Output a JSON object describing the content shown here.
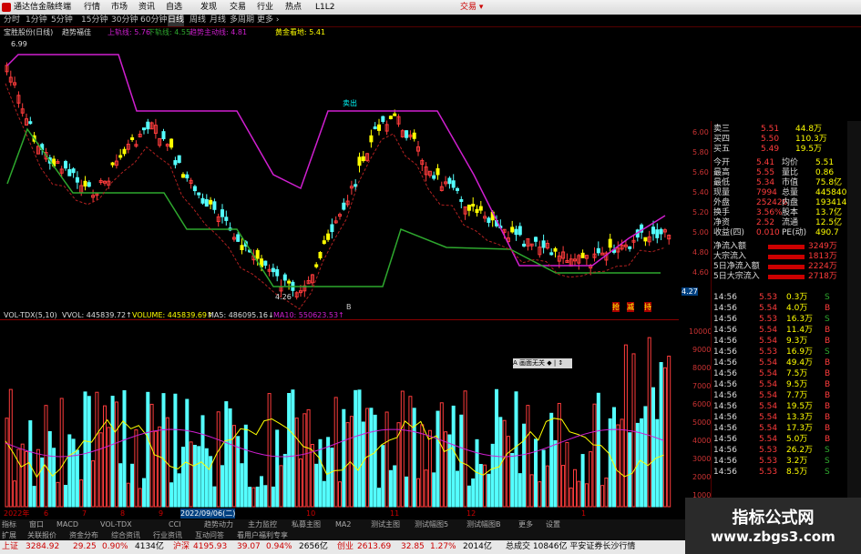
{
  "window": {
    "title": "通达信金融终端",
    "menu": [
      "行情",
      "市场",
      "资讯",
      "自选",
      "发现",
      "交易",
      "行业",
      "热点",
      "L1L2"
    ],
    "right_label": "交易 ▾"
  },
  "periods": [
    "分时",
    "1分钟",
    "5分钟",
    "15分钟",
    "30分钟",
    "60分钟",
    "日线",
    "周线",
    "月线",
    "多周期",
    "更多 ›"
  ],
  "active_period": "日线",
  "info": {
    "stock": "宝胜股份(日线)",
    "indicator": "趋势福佳",
    "upper": "上轨线: 5.76",
    "lower": "下轨线: 4.55",
    "main": "趋势主动线: 4.81",
    "gold": "黄金看地: 5.41"
  },
  "chart_labels": {
    "high": "6.99",
    "low": "4.26",
    "sell": "卖出",
    "buy_markers": [
      "抢",
      "减",
      "持"
    ],
    "b_marker": "B",
    "right_price": "4.27"
  },
  "price_axis": [
    "6.00",
    "5.80",
    "5.60",
    "5.40",
    "5.20",
    "5.00",
    "4.80",
    "4.60"
  ],
  "vol_info": {
    "name": "VOL-TDX(5,10)",
    "vvol": "VVOL: 445839.72↑",
    "volume": "VOLUME: 445839.69↑",
    "ma5": "MA5: 486095.16↓",
    "ma10": "MA10: 550623.53↑"
  },
  "vol_axis": [
    "10000",
    "9000",
    "8000",
    "7000",
    "6000",
    "5000",
    "4000",
    "3000",
    "2000",
    "1000"
  ],
  "popup": "A 画面无关 ◆ | ↕",
  "date_axis": [
    "2022年",
    "6",
    "7",
    "8",
    "9",
    "2022/09/06(二)",
    "10",
    "11",
    "12",
    "1"
  ],
  "quotes": [
    {
      "label": "卖三",
      "price": "5.51",
      "vol": "44.8万"
    },
    {
      "label": "买四",
      "price": "5.50",
      "vol": "110.3万"
    },
    {
      "label": "买五",
      "price": "5.49",
      "vol": "19.5万"
    }
  ],
  "stats": [
    {
      "l1": "今开",
      "v1": "5.41",
      "l2": "均价",
      "v2": "5.51"
    },
    {
      "l1": "最高",
      "v1": "5.55",
      "l2": "量比",
      "v2": "0.86"
    },
    {
      "l1": "最低",
      "v1": "5.34",
      "l2": "市值",
      "v2": "75.8亿"
    },
    {
      "l1": "现量",
      "v1": "7994",
      "l2": "总量",
      "v2": "445840"
    },
    {
      "l1": "外盘",
      "v1": "252426",
      "l2": "内盘",
      "v2": "193414"
    },
    {
      "l1": "换手",
      "v1": "3.56%",
      "l2": "股本",
      "v2": "13.7亿"
    },
    {
      "l1": "净资",
      "v1": "2.52",
      "l2": "流通",
      "v2": "12.5亿"
    },
    {
      "l1": "收益(四)",
      "v1": "0.010",
      "l2": "PE(动)",
      "v2": "490.7"
    }
  ],
  "flows": [
    {
      "label": "净流入额",
      "value": "3249万"
    },
    {
      "label": "大宗流入",
      "value": "1813万"
    },
    {
      "label": "5日净流入额",
      "value": "2224万"
    },
    {
      "label": "5日大宗流入",
      "value": "2718万"
    }
  ],
  "trades": [
    {
      "t": "14:56",
      "p": "5.53",
      "v": "0.3万",
      "s": "S"
    },
    {
      "t": "14:56",
      "p": "5.54",
      "v": "4.0万",
      "s": "B"
    },
    {
      "t": "14:56",
      "p": "5.53",
      "v": "16.3万",
      "s": "S"
    },
    {
      "t": "14:56",
      "p": "5.54",
      "v": "11.4万",
      "s": "B"
    },
    {
      "t": "14:56",
      "p": "5.54",
      "v": "9.3万",
      "s": "B"
    },
    {
      "t": "14:56",
      "p": "5.53",
      "v": "16.9万",
      "s": "S"
    },
    {
      "t": "14:56",
      "p": "5.54",
      "v": "49.4万",
      "s": "B"
    },
    {
      "t": "14:56",
      "p": "5.54",
      "v": "7.5万",
      "s": "B"
    },
    {
      "t": "14:56",
      "p": "5.54",
      "v": "9.5万",
      "s": "B"
    },
    {
      "t": "14:56",
      "p": "5.54",
      "v": "7.7万",
      "s": "B"
    },
    {
      "t": "14:56",
      "p": "5.54",
      "v": "19.5万",
      "s": "B"
    },
    {
      "t": "14:56",
      "p": "5.54",
      "v": "13.3万",
      "s": "B"
    },
    {
      "t": "14:56",
      "p": "5.54",
      "v": "17.3万",
      "s": "B"
    },
    {
      "t": "14:56",
      "p": "5.54",
      "v": "5.0万",
      "s": "B"
    },
    {
      "t": "14:56",
      "p": "5.53",
      "v": "26.2万",
      "s": "S"
    },
    {
      "t": "14:56",
      "p": "5.53",
      "v": "3.2万",
      "s": "S"
    },
    {
      "t": "14:56",
      "p": "5.53",
      "v": "8.5万",
      "s": "S"
    }
  ],
  "tabs": [
    "指标",
    "窗口",
    "MACD",
    "VOL-TDX",
    "CCI",
    "趋势动力",
    "主力监控",
    "私募主图",
    "MA2",
    "测试主图",
    "测试幅图5",
    "测试幅图B",
    "更多",
    "设置"
  ],
  "tabs2": [
    "扩展",
    "关联报价",
    "资金分布",
    "综合资讯",
    "行业资讯",
    "互动问答",
    "看用户福利专享"
  ],
  "statusbar": [
    {
      "label": "上证",
      "value": "3284.92",
      "chg": "29.25",
      "pct": "0.90%",
      "amt": "4134亿"
    },
    {
      "label": "沪深",
      "value": "4195.93",
      "chg": "39.07",
      "pct": "0.94%",
      "amt": "2656亿"
    },
    {
      "label": "创业",
      "value": "2613.69",
      "chg": "32.85",
      "pct": "1.27%",
      "amt": "2014亿"
    }
  ],
  "status_tail": "总成交 10846亿 平安证券长沙行情",
  "watermark": {
    "line1": "指标公式网",
    "line2": "www.zbgs3.com"
  },
  "colors": {
    "up": "#ff3c3c",
    "down": "#54ffff",
    "yellow": "#ffff00",
    "magenta": "#d01fd0",
    "green": "#2ea82e"
  }
}
